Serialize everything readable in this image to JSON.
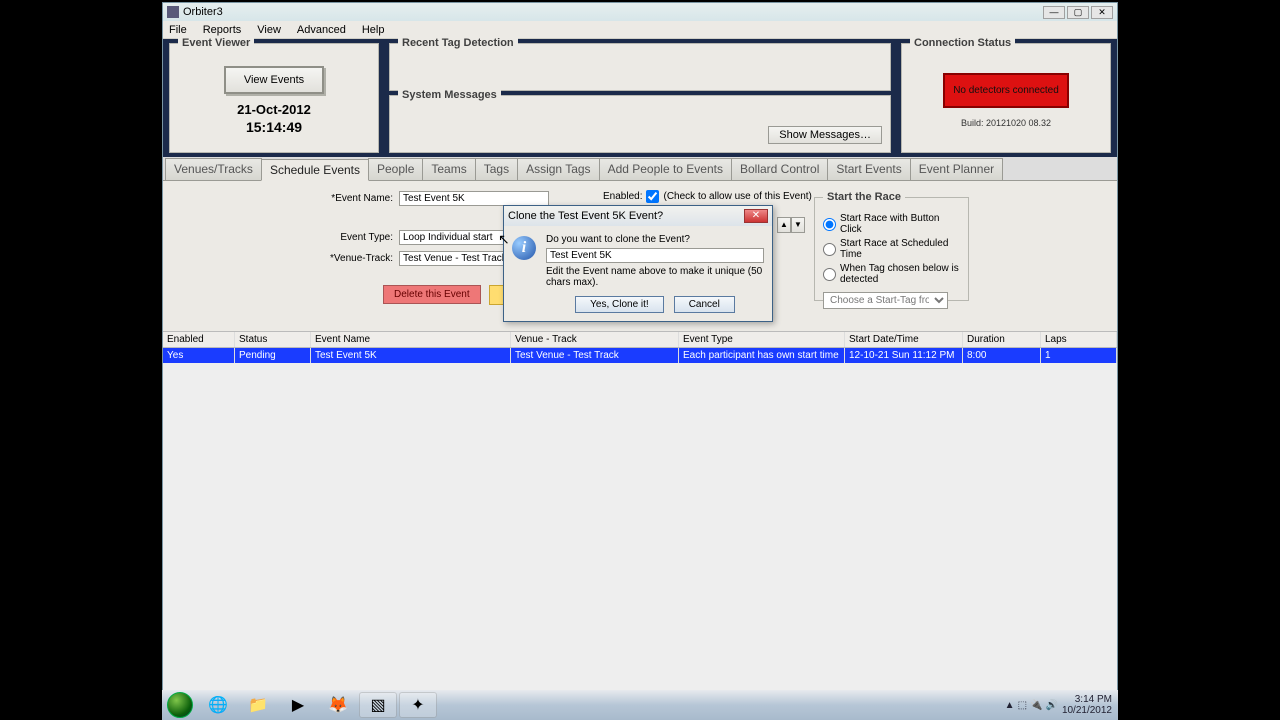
{
  "window": {
    "title": "Orbiter3"
  },
  "menu": [
    "File",
    "Reports",
    "View",
    "Advanced",
    "Help"
  ],
  "event_viewer": {
    "legend": "Event Viewer",
    "view_events_btn": "View Events",
    "date": "21-Oct-2012",
    "time": "15:14:49"
  },
  "recent_tag": {
    "legend": "Recent Tag Detection"
  },
  "system_messages": {
    "legend": "System Messages",
    "show_btn": "Show Messages…"
  },
  "connection": {
    "legend": "Connection Status",
    "no_detectors": "No detectors connected",
    "build": "Build: 20121020 08.32"
  },
  "tabs": [
    "Venues/Tracks",
    "Schedule Events",
    "People",
    "Teams",
    "Tags",
    "Assign Tags",
    "Add People to Events",
    "Bollard Control",
    "Start Events",
    "Event Planner"
  ],
  "active_tab": 1,
  "form": {
    "labels": {
      "name": "*Event Name:",
      "type": "Event Type:",
      "venue": "*Venue-Track:"
    },
    "event_name": "Test Event 5K",
    "event_type": "Loop Individual start",
    "venue_track": "Test Venue - Test Track",
    "enabled_label": "Enabled:",
    "enabled_hint": "(Check to allow use of this Event)",
    "delete_btn": "Delete this Event"
  },
  "start_race": {
    "legend": "Start the Race",
    "opt1": "Start Race with Button Click",
    "opt2": "Start Race at Scheduled Time",
    "opt3": "When Tag chosen below is detected",
    "select_placeholder": "Choose a Start-Tag from this List"
  },
  "grid": {
    "headers": [
      "Enabled",
      "Status",
      "Event Name",
      "Venue - Track",
      "Event Type",
      "Start Date/Time",
      "Duration",
      "Laps"
    ],
    "rows": [
      [
        "Yes",
        "Pending",
        "Test Event 5K",
        "Test Venue - Test Track",
        "Each participant has own start time",
        "12-10-21 Sun 11:12 PM",
        "8:00",
        "1"
      ]
    ]
  },
  "dialog": {
    "title": "Clone the Test Event 5K Event?",
    "question": "Do you want to clone the Event?",
    "input_value": "Test Event 5K",
    "hint": "Edit the Event name above to make it unique (50 chars max).",
    "yes_btn": "Yes, Clone it!",
    "cancel_btn": "Cancel"
  },
  "taskbar": {
    "time": "3:14 PM",
    "date": "10/21/2012"
  }
}
